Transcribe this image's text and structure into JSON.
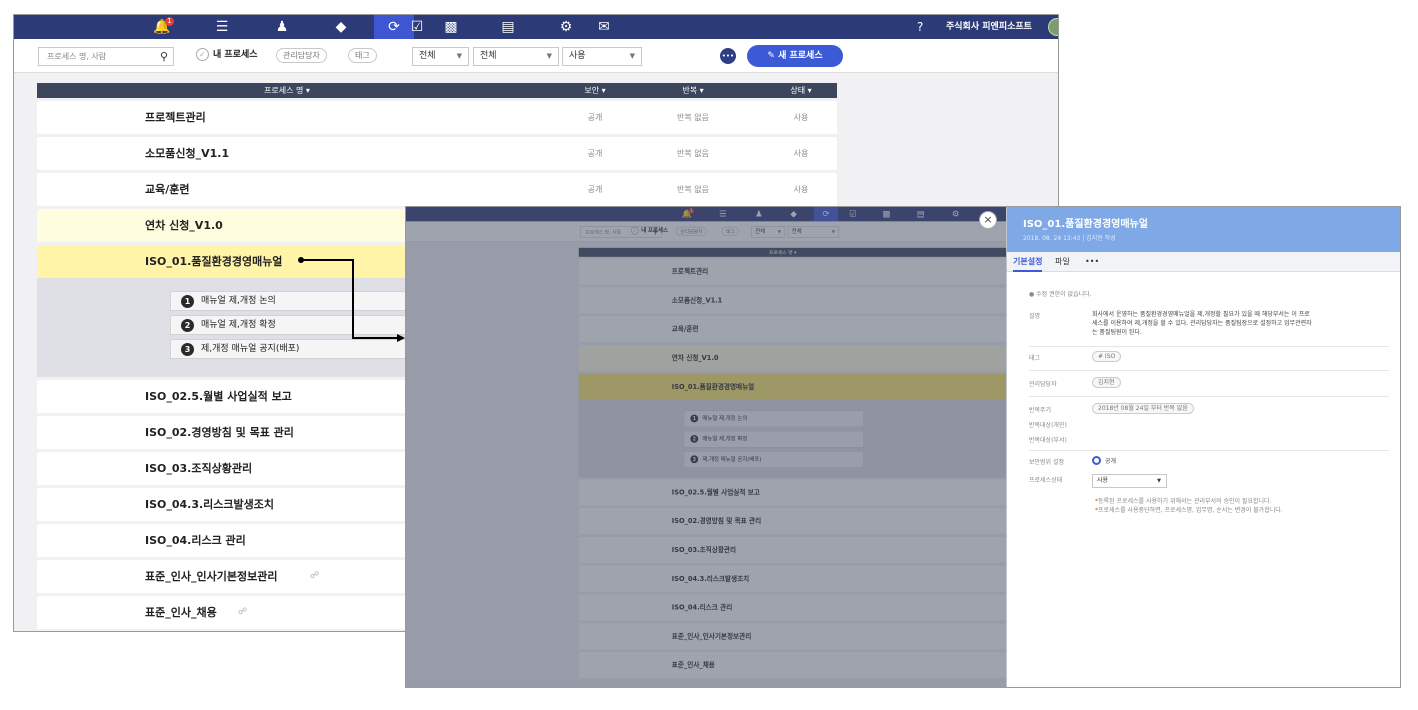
{
  "topbar": {
    "alert_badge": "1",
    "help_icon": "?",
    "company": "주식회사 피엔피소프트"
  },
  "filters": {
    "search_placeholder": "프로세스 명, 사람",
    "my_process": "내 프로세스",
    "manager_pill": "관리담당자",
    "tag_pill": "태그",
    "select1": "전체",
    "select2": "전체",
    "select3": "사용",
    "new_process": "새 프로세스"
  },
  "table": {
    "columns": [
      "프로세스 명 ▾",
      "보안 ▾",
      "반복 ▾",
      "상태 ▾"
    ],
    "rows": [
      {
        "name": "프로젝트관리",
        "security": "공개",
        "repeat": "반복 없음",
        "status": "사용"
      },
      {
        "name": "소모품신청_V1.1",
        "security": "공개",
        "repeat": "반복 없음",
        "status": "사용"
      },
      {
        "name": "교육/훈련",
        "security": "공개",
        "repeat": "반복 없음",
        "status": "사용"
      },
      {
        "name": "연차 신청_V1.0",
        "security": "",
        "repeat": "",
        "status": ""
      },
      {
        "name": "ISO_01.품질환경경영매뉴얼",
        "security": "",
        "repeat": "",
        "status": ""
      },
      {
        "name": "ISO_02.5.월별 사업실적 보고"
      },
      {
        "name": "ISO_02.경영방침 및 목표 관리"
      },
      {
        "name": "ISO_03.조직상황관리"
      },
      {
        "name": "ISO_04.3.리스크발생조치"
      },
      {
        "name": "ISO_04.리스크 관리"
      },
      {
        "name": "표준_인사_인사기본정보관리"
      },
      {
        "name": "표준_인사_채용"
      }
    ],
    "steps": [
      {
        "num": "1",
        "label": "매뉴얼 제,개정 논의"
      },
      {
        "num": "2",
        "label": "매뉴얼 제,개정 확정"
      },
      {
        "num": "3",
        "label": "제,개정 매뉴얼 공지(배포)"
      }
    ]
  },
  "panel": {
    "close": "×",
    "title": "ISO_01.품질환경경영매뉴얼",
    "subtitle": "2018. 08. 24 13:43 | 김지현 작성",
    "tabs": [
      "기본설정",
      "파일",
      "•••"
    ],
    "no_permission": "● 수정 권한이 없습니다.",
    "desc_label": "설명",
    "desc": "회사에서 운영하는 품질환경경영매뉴얼을 제,개정할 필요가 있을 때 해당부서는 이 프로세스를 이용하여 제,개정을 할 수 있다. 관리담당자는 품질팀장으로 설정하고 업무관련자는 품질팀원이 된다.",
    "tag_label": "태그",
    "tag": "# ISO",
    "manager_label": "관리담당자",
    "manager": "김지현",
    "cycle_label": "반복주기",
    "cycle": "2018년 08월 24일 부터 반복 없음",
    "target_person_label": "반복대상(개인)",
    "target_dept_label": "반복대상(부서)",
    "security_label": "보안범위 설정",
    "security": "공개",
    "state_label": "프로세스상태",
    "state": "사용",
    "note1": "등록된 프로세스를 사용하기 위해서는 관리부서의 승인이 필요합니다.",
    "note2": "프로세스를 사용중단하면, 프로세스명, 업무명, 순서는 변경이 불가합니다.",
    "note_mark": "*"
  },
  "colors": {
    "topbar": "#2c3a78",
    "accent": "#3d5ad6",
    "selected_row": "#fff4a8",
    "panel_header": "#7ea8e6"
  },
  "icons": [
    "bell-icon",
    "list-icon",
    "people-icon",
    "layers-icon",
    "process-cycle-icon",
    "checkbox-icon",
    "chart-icon",
    "calendar-icon",
    "settings-icon",
    "mail-icon",
    "help-icon",
    "search-icon",
    "chat-icon",
    "pencil-icon",
    "lock-icon",
    "arrow-connector"
  ]
}
